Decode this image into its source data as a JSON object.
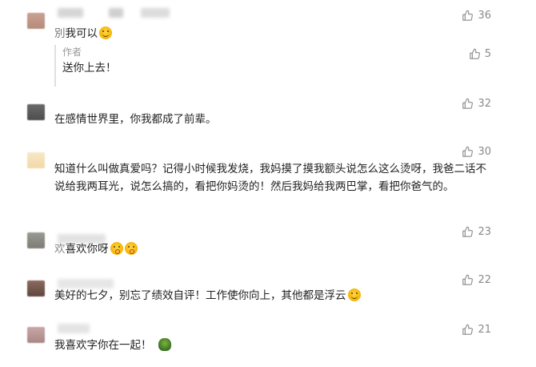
{
  "colors": {
    "like_gray": "#8a8a8a",
    "text": "#222222",
    "role_gray": "#999999"
  },
  "comments": [
    {
      "text": "我可以",
      "likes": "36",
      "emoji": "grin"
    },
    {
      "text": "在感情世界里，你我都成了前辈。",
      "likes": "32"
    },
    {
      "text": "知道什么叫做真爱吗？记得小时候我发烧，我妈摸了摸我额头说怎么这么烫呀，我爸二话不说给我两耳光，说怎么搞的，看把你妈烫的！然后我妈给我两巴掌，看把你爸气的。",
      "likes": "30"
    },
    {
      "text": "喜欢你呀",
      "likes": "23",
      "emoji": "kiss"
    },
    {
      "text": "美好的七夕，别忘了绩效自评！工作使你向上，其他都是浮云",
      "likes": "22",
      "emoji": "grin"
    },
    {
      "text": "我喜欢字你在一起！",
      "likes": "21",
      "emoji": "turtle"
    }
  ],
  "author_reply": {
    "role": "作者",
    "text": "送你上去！",
    "likes": "5"
  },
  "icons": {
    "like": "thumbs-up-icon"
  }
}
